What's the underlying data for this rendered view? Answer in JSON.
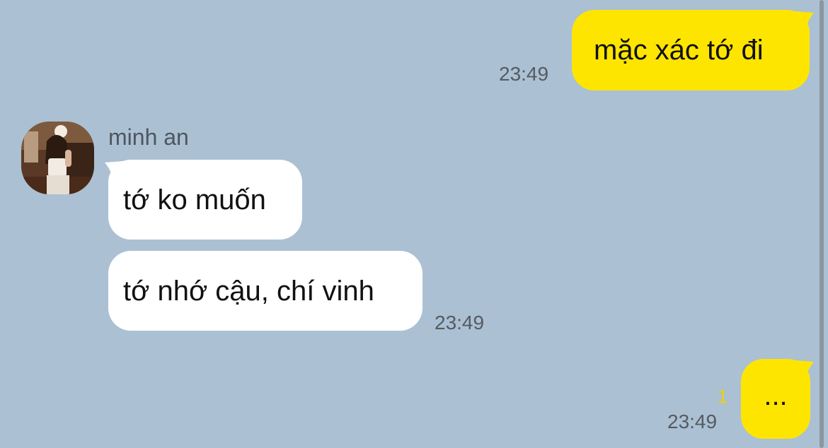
{
  "messages": [
    {
      "id": "m1",
      "direction": "out",
      "text": "mặc xác tớ đi",
      "time": "23:49"
    },
    {
      "id": "m2",
      "direction": "in",
      "sender": "minh an",
      "text": "tớ ko muốn"
    },
    {
      "id": "m3",
      "direction": "in",
      "text": "tớ nhớ cậu, chí vinh",
      "time": "23:49"
    },
    {
      "id": "m4",
      "direction": "out",
      "text": "...",
      "time": "23:49",
      "unread_count": "1"
    }
  ],
  "colors": {
    "background": "#abc0d3",
    "outgoing_bubble": "#fee500",
    "incoming_bubble": "#ffffff",
    "unread_indicator": "#f0d200"
  },
  "icons": {
    "avatar": "profile-photo-avatar"
  }
}
